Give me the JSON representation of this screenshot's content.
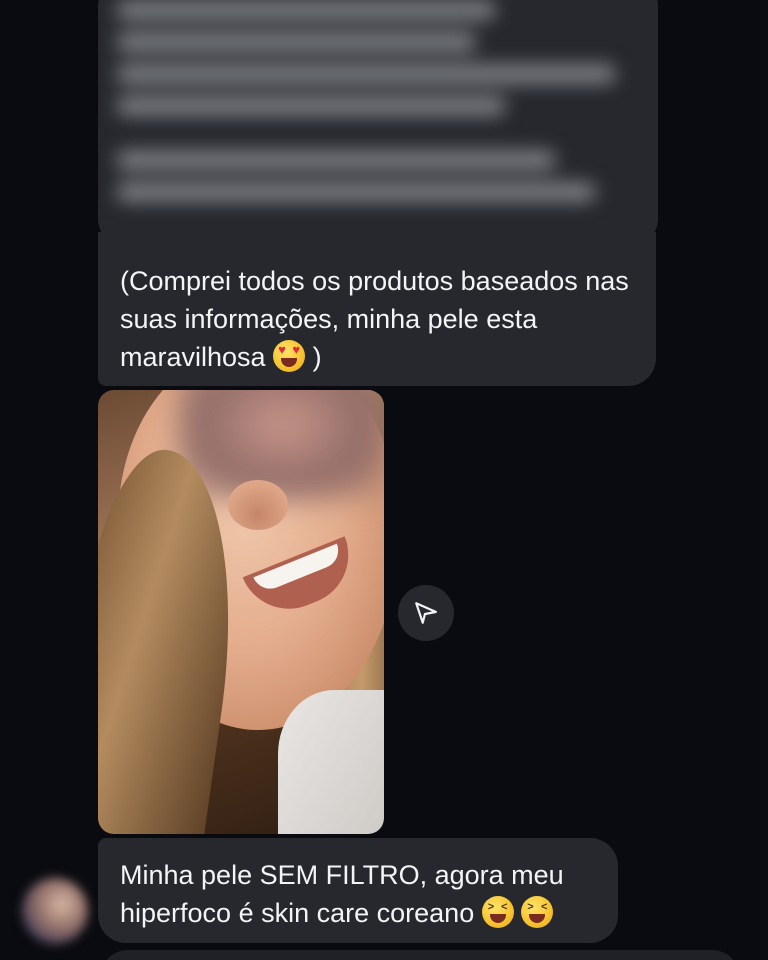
{
  "messages": [
    {
      "type": "text",
      "text": "(Comprei todos os produtos baseados nas suas informações, minha pele esta maravilhosa",
      "suffix": ")",
      "emoji": "heart-eyes-emoji"
    },
    {
      "type": "image",
      "share_icon": "send-icon"
    },
    {
      "type": "text",
      "text": "Minha pele SEM FILTRO, agora meu hiperfoco é skin care coreano",
      "emoji": "grinning-squinting-emoji"
    }
  ],
  "colors": {
    "background": "#0a0b10",
    "bubble": "#26282e",
    "text": "#f3f4f6"
  }
}
